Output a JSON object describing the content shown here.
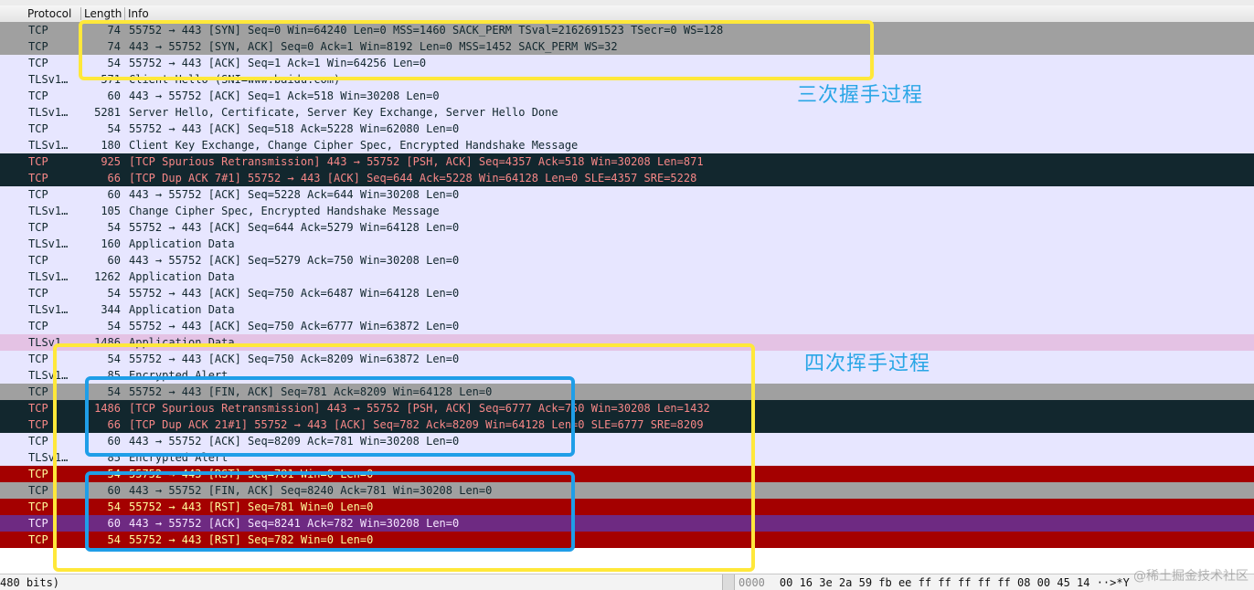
{
  "columns": {
    "protocol": "Protocol",
    "length": "Length",
    "info": "Info"
  },
  "packets": [
    {
      "protocol": "TCP",
      "length": "74",
      "info": "55752 → 443 [SYN] Seq=0 Win=64240 Len=0 MSS=1460 SACK_PERM TSval=2162691523 TSecr=0 WS=128",
      "style": "gray"
    },
    {
      "protocol": "TCP",
      "length": "74",
      "info": "443 → 55752 [SYN, ACK] Seq=0 Ack=1 Win=8192 Len=0 MSS=1452 SACK_PERM WS=32",
      "style": "gray"
    },
    {
      "protocol": "TCP",
      "length": "54",
      "info": "55752 → 443 [ACK] Seq=1 Ack=1 Win=64256 Len=0",
      "style": "lav"
    },
    {
      "protocol": "TLSv1…",
      "length": "571",
      "info": "Client Hello (SNI=www.baidu.com)",
      "style": "lav"
    },
    {
      "protocol": "TCP",
      "length": "60",
      "info": "443 → 55752 [ACK] Seq=1 Ack=518 Win=30208 Len=0",
      "style": "lav"
    },
    {
      "protocol": "TLSv1…",
      "length": "5281",
      "info": "Server Hello, Certificate, Server Key Exchange, Server Hello Done",
      "style": "lav"
    },
    {
      "protocol": "TCP",
      "length": "54",
      "info": "55752 → 443 [ACK] Seq=518 Ack=5228 Win=62080 Len=0",
      "style": "lav"
    },
    {
      "protocol": "TLSv1…",
      "length": "180",
      "info": "Client Key Exchange, Change Cipher Spec, Encrypted Handshake Message",
      "style": "lav"
    },
    {
      "protocol": "TCP",
      "length": "925",
      "info": "[TCP Spurious Retransmission] 443 → 55752 [PSH, ACK] Seq=4357 Ack=518 Win=30208 Len=871",
      "style": "dark"
    },
    {
      "protocol": "TCP",
      "length": "66",
      "info": "[TCP Dup ACK 7#1] 55752 → 443 [ACK] Seq=644 Ack=5228 Win=64128 Len=0 SLE=4357 SRE=5228",
      "style": "dark"
    },
    {
      "protocol": "TCP",
      "length": "60",
      "info": "443 → 55752 [ACK] Seq=5228 Ack=644 Win=30208 Len=0",
      "style": "lav"
    },
    {
      "protocol": "TLSv1…",
      "length": "105",
      "info": "Change Cipher Spec, Encrypted Handshake Message",
      "style": "lav"
    },
    {
      "protocol": "TCP",
      "length": "54",
      "info": "55752 → 443 [ACK] Seq=644 Ack=5279 Win=64128 Len=0",
      "style": "lav"
    },
    {
      "protocol": "TLSv1…",
      "length": "160",
      "info": "Application Data",
      "style": "lav"
    },
    {
      "protocol": "TCP",
      "length": "60",
      "info": "443 → 55752 [ACK] Seq=5279 Ack=750 Win=30208 Len=0",
      "style": "lav"
    },
    {
      "protocol": "TLSv1…",
      "length": "1262",
      "info": "Application Data",
      "style": "lav"
    },
    {
      "protocol": "TCP",
      "length": "54",
      "info": "55752 → 443 [ACK] Seq=750 Ack=6487 Win=64128 Len=0",
      "style": "lav"
    },
    {
      "protocol": "TLSv1…",
      "length": "344",
      "info": "Application Data",
      "style": "lav"
    },
    {
      "protocol": "TCP",
      "length": "54",
      "info": "55752 → 443 [ACK] Seq=750 Ack=6777 Win=63872 Len=0",
      "style": "lav"
    },
    {
      "protocol": "TLSv1…",
      "length": "1486",
      "info": "Application Data",
      "style": "pink"
    },
    {
      "protocol": "TCP",
      "length": "54",
      "info": "55752 → 443 [ACK] Seq=750 Ack=8209 Win=63872 Len=0",
      "style": "lav"
    },
    {
      "protocol": "TLSv1…",
      "length": "85",
      "info": "Encrypted Alert",
      "style": "lav"
    },
    {
      "protocol": "TCP",
      "length": "54",
      "info": "55752 → 443 [FIN, ACK] Seq=781 Ack=8209 Win=64128 Len=0",
      "style": "gray"
    },
    {
      "protocol": "TCP",
      "length": "1486",
      "info": "[TCP Spurious Retransmission] 443 → 55752 [PSH, ACK] Seq=6777 Ack=750 Win=30208 Len=1432",
      "style": "dark"
    },
    {
      "protocol": "TCP",
      "length": "66",
      "info": "[TCP Dup ACK 21#1] 55752 → 443 [ACK] Seq=782 Ack=8209 Win=64128 Len=0 SLE=6777 SRE=8209",
      "style": "dark"
    },
    {
      "protocol": "TCP",
      "length": "60",
      "info": "443 → 55752 [ACK] Seq=8209 Ack=781 Win=30208 Len=0",
      "style": "lav"
    },
    {
      "protocol": "TLSv1…",
      "length": "85",
      "info": "Encrypted Alert",
      "style": "lav"
    },
    {
      "protocol": "TCP",
      "length": "54",
      "info": "55752 → 443 [RST] Seq=781 Win=0 Len=0",
      "style": "red"
    },
    {
      "protocol": "TCP",
      "length": "60",
      "info": "443 → 55752 [FIN, ACK] Seq=8240 Ack=781 Win=30208 Len=0",
      "style": "gray"
    },
    {
      "protocol": "TCP",
      "length": "54",
      "info": "55752 → 443 [RST] Seq=781 Win=0 Len=0",
      "style": "red"
    },
    {
      "protocol": "TCP",
      "length": "60",
      "info": "443 → 55752 [ACK] Seq=8241 Ack=782 Win=30208 Len=0",
      "style": "purple"
    },
    {
      "protocol": "TCP",
      "length": "54",
      "info": "55752 → 443 [RST] Seq=782 Win=0 Len=0",
      "style": "red"
    }
  ],
  "annotations": {
    "handshake": "三次握手过程",
    "wave": "四次挥手过程"
  },
  "status": {
    "bits": "480 bits)",
    "hex_offset": "0000",
    "hex_bytes": "00 16 3e 2a 59 fb ee ff  ff ff ff ff 08 00 45 14",
    "hex_ascii": "··>*Y"
  },
  "watermark": "@稀土掘金技术社区",
  "colors": {
    "row_default": "#e7e6ff",
    "row_gray": "#a0a0a0",
    "row_dark": "#12272e",
    "row_red": "#a40000",
    "row_pink": "#e4c2e4",
    "row_purple": "#6e2a82",
    "box_yellow": "#ffe83a",
    "box_blue": "#1f9ee8",
    "annotation_text": "#2aa6e6"
  }
}
